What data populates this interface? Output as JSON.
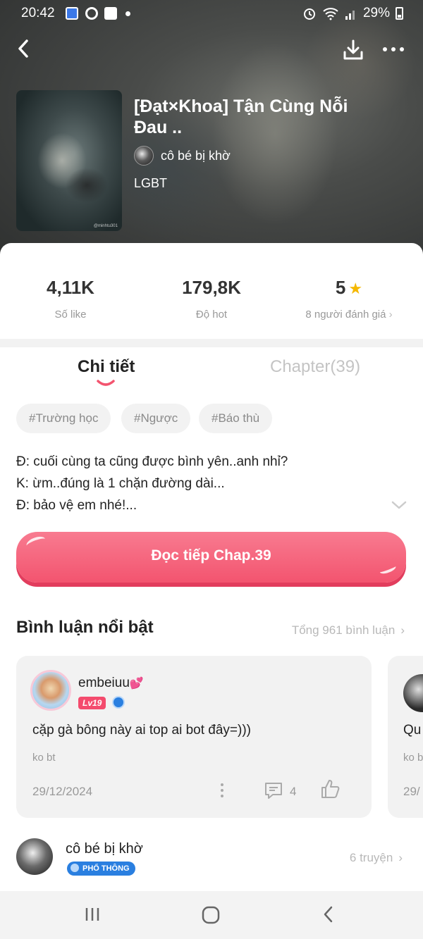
{
  "status": {
    "time": "20:42",
    "battery": "29%"
  },
  "story": {
    "title": "[Đạt×Khoa] Tận Cùng Nỗi Đau ..",
    "author": "cô bé bị khờ",
    "genre": "LGBT",
    "cover_watermark": "@minhtu301"
  },
  "stats": {
    "likes_value": "4,11K",
    "likes_label": "Số like",
    "hot_value": "179,8K",
    "hot_label": "Độ hot",
    "rating_value": "5",
    "rating_label": "8 người đánh giá"
  },
  "tabs": {
    "detail": "Chi tiết",
    "chapters": "Chapter(39)"
  },
  "tags": [
    "#Trường học",
    "#Ngược",
    "#Báo thù"
  ],
  "description": [
    "Đ: cuối cùng ta cũng được bình yên..anh nhỉ?",
    "K: ừm..đúng là 1 chặn đường dài...",
    "Đ: bảo vệ em nhé!..."
  ],
  "read_button": "Đọc tiếp Chap.39",
  "comments_section": {
    "title": "Bình luận nổi bật",
    "total": "Tổng 961 bình luận"
  },
  "comments": [
    {
      "user": "embeiuu",
      "level": "Lv19",
      "text": "cặp gà bông này ai top ai bot đây=)))",
      "sub": "ko bt",
      "date": "29/12/2024",
      "reply_count": "4"
    },
    {
      "text": "Qu",
      "sub": "ko b",
      "date": "29/"
    }
  ],
  "author_section": {
    "name": "cô bé bị khờ",
    "badge": "PHỔ THÔNG",
    "count": "6 truyện"
  },
  "colors": {
    "accent": "#f3546f",
    "star": "#f5b800",
    "badge_blue": "#2a7fe0"
  }
}
